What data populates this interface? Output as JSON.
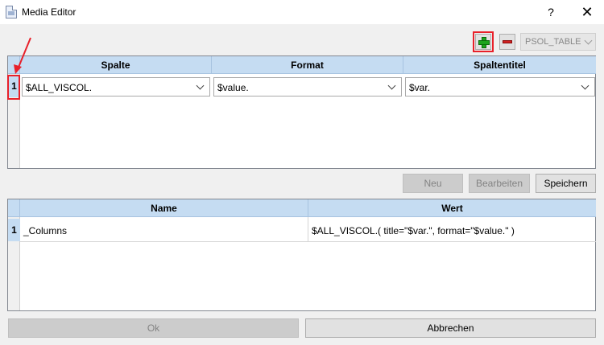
{
  "window": {
    "title": "Media Editor",
    "help": "?",
    "close": "✕"
  },
  "toolbar": {
    "table_selector": "PSOL_TABLE"
  },
  "columns_grid": {
    "headers": [
      "Spalte",
      "Format",
      "Spaltentitel"
    ],
    "rows": [
      {
        "num": "1",
        "spalte": "$ALL_VISCOL.",
        "format": "$value.",
        "spaltentitel": "$var."
      }
    ]
  },
  "actions": {
    "neu": "Neu",
    "bearbeiten": "Bearbeiten",
    "speichern": "Speichern"
  },
  "properties_grid": {
    "headers": [
      "Name",
      "Wert"
    ],
    "rows": [
      {
        "num": "1",
        "name": "_Columns",
        "wert": "$ALL_VISCOL.( title=\"$var.\", format=\"$value.\" )"
      }
    ]
  },
  "footer": {
    "ok": "Ok",
    "cancel": "Abbrechen"
  },
  "colors": {
    "header_bg": "#c5dcf2",
    "highlight": "#e8202a",
    "add_green": "#1ea41e",
    "remove_red": "#d02020"
  }
}
